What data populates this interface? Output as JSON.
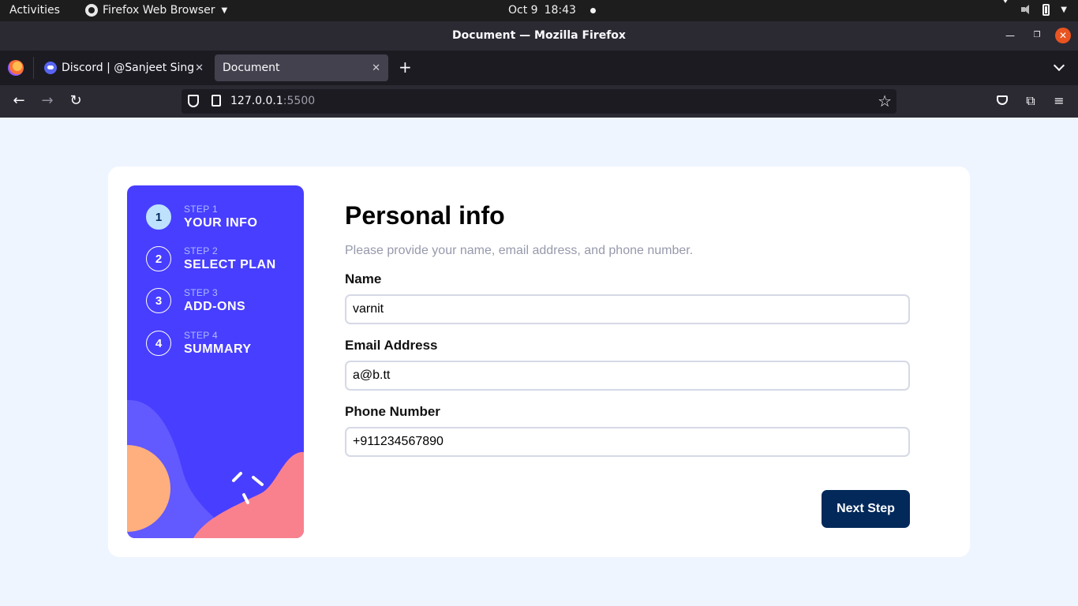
{
  "system_bar": {
    "activities": "Activities",
    "app_name": "Firefox Web Browser",
    "date": "Oct 9",
    "time": "18:43"
  },
  "window": {
    "title": "Document — Mozilla Firefox"
  },
  "tabs": [
    {
      "label": "Discord | @Sanjeet Singh",
      "icon": "discord-icon",
      "active": false
    },
    {
      "label": "Document",
      "icon": null,
      "active": true
    }
  ],
  "navbar": {
    "url_host": "127.0.0.1",
    "url_port": ":5500"
  },
  "sidebar": {
    "steps": [
      {
        "number": "1",
        "step_label": "STEP 1",
        "title": "YOUR INFO",
        "active": true
      },
      {
        "number": "2",
        "step_label": "STEP 2",
        "title": "SELECT PLAN",
        "active": false
      },
      {
        "number": "3",
        "step_label": "STEP 3",
        "title": "ADD-ONS",
        "active": false
      },
      {
        "number": "4",
        "step_label": "STEP 4",
        "title": "SUMMARY",
        "active": false
      }
    ]
  },
  "form": {
    "heading": "Personal info",
    "subtitle": "Please provide your name, email address, and phone number.",
    "fields": [
      {
        "label": "Name",
        "value": "varnit"
      },
      {
        "label": "Email Address",
        "value": "a@b.tt"
      },
      {
        "label": "Phone Number",
        "value": "+911234567890"
      }
    ],
    "next_label": "Next Step"
  },
  "colors": {
    "page_bg": "#eff5ff",
    "sidebar_bg": "#483eff",
    "active_step": "#bee2fd",
    "primary_button": "#02295a",
    "input_border": "#d6d9e6",
    "subtitle": "#9699ab"
  }
}
